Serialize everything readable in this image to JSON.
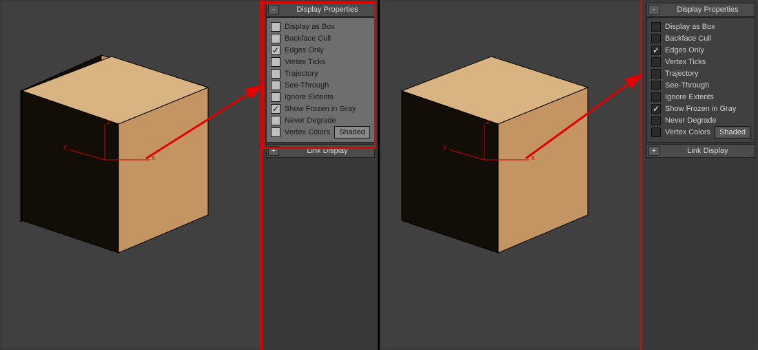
{
  "panelA": {
    "variant": "light",
    "rollups": {
      "display": {
        "sign": "-",
        "title": "Display Properties"
      },
      "link": {
        "sign": "+",
        "title": "Link Display"
      }
    },
    "options": [
      {
        "label": "Display as Box",
        "checked": false
      },
      {
        "label": "Backface Cull",
        "checked": false
      },
      {
        "label": "Edges Only",
        "checked": true
      },
      {
        "label": "Vertex Ticks",
        "checked": false
      },
      {
        "label": "Trajectory",
        "checked": false
      },
      {
        "label": "See-Through",
        "checked": false
      },
      {
        "label": "Ignore Extents",
        "checked": false
      },
      {
        "label": "Show Frozen in Gray",
        "checked": true
      },
      {
        "label": "Never Degrade",
        "checked": false
      },
      {
        "label": "Vertex Colors",
        "checked": false,
        "button": "Shaded"
      }
    ]
  },
  "panelB": {
    "variant": "dark",
    "rollups": {
      "display": {
        "sign": "-",
        "title": "Display Properties"
      },
      "link": {
        "sign": "+",
        "title": "Link Display"
      }
    },
    "options": [
      {
        "label": "Display as Box",
        "checked": false
      },
      {
        "label": "Backface Cull",
        "checked": false
      },
      {
        "label": "Edges Only",
        "checked": true
      },
      {
        "label": "Vertex Ticks",
        "checked": false
      },
      {
        "label": "Trajectory",
        "checked": false
      },
      {
        "label": "See-Through",
        "checked": false
      },
      {
        "label": "Ignore Extents",
        "checked": false
      },
      {
        "label": "Show Frozen in Gray",
        "checked": true
      },
      {
        "label": "Never Degrade",
        "checked": false
      },
      {
        "label": "Vertex Colors",
        "checked": false,
        "button": "Shaded"
      }
    ]
  },
  "gizmo": {
    "x": "x",
    "y": "y",
    "z": "z"
  },
  "colors": {
    "cube_top": "#d9b482",
    "cube_right": "#c49563",
    "cube_left": "#120d06",
    "edge": "#000000",
    "arrow": "#e30000"
  }
}
